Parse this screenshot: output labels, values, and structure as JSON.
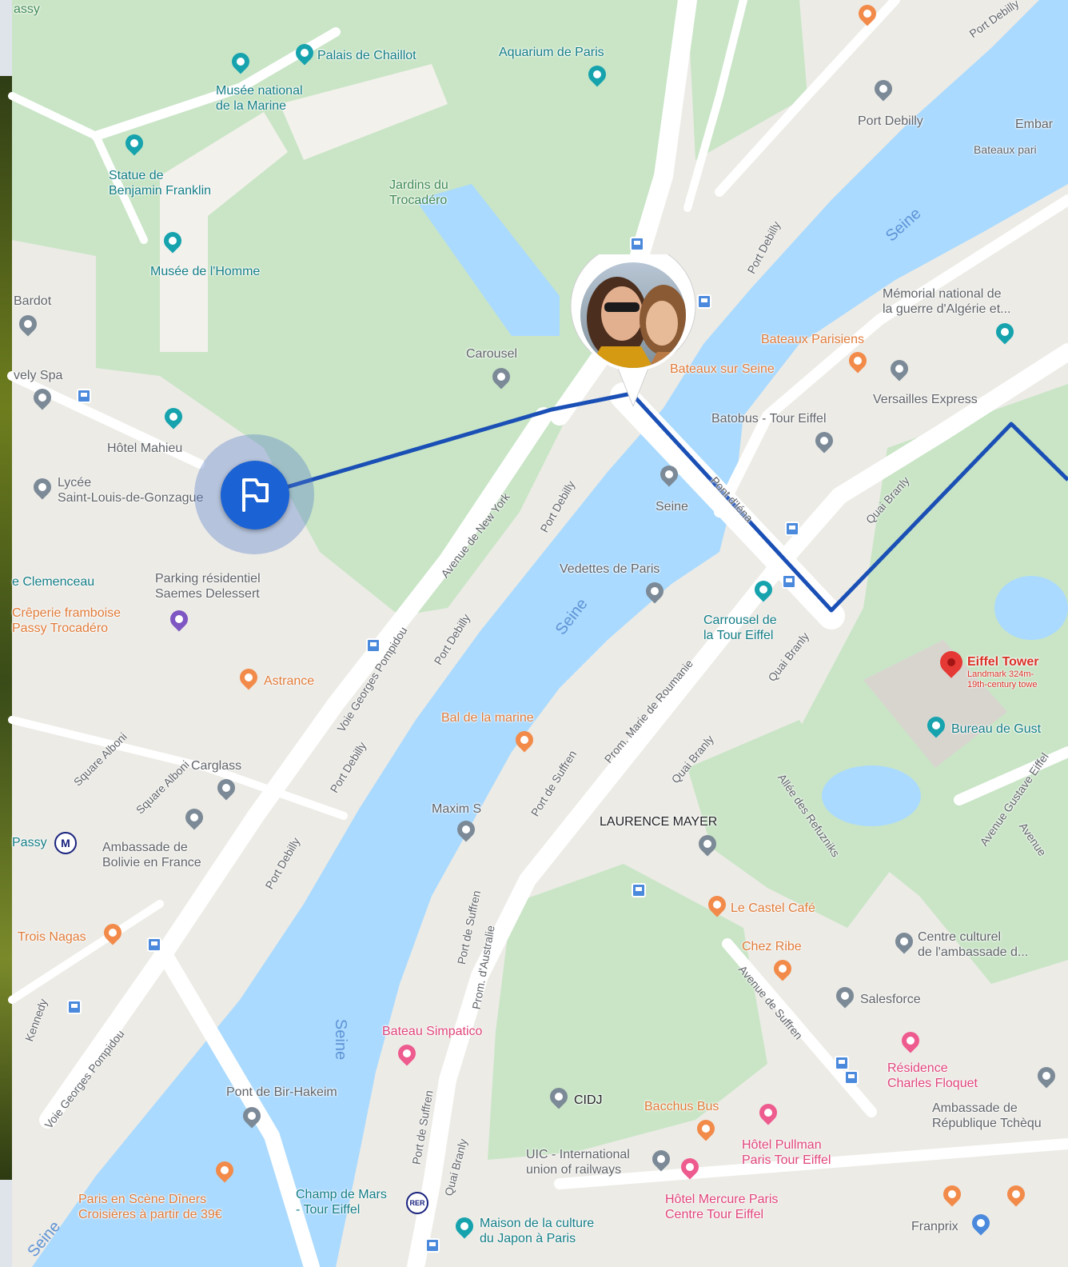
{
  "map": {
    "water": [
      "Seine",
      "Seine",
      "Seine",
      "Seine",
      "Seine"
    ],
    "places": {
      "passy_top": "assy",
      "palais_chaillot": "Palais de Chaillot",
      "aquarium": "Aquarium de Paris",
      "musee_marine": "Musée national\nde la Marine",
      "statue_franklin": "Statue de\nBenjamin Franklin",
      "jardins": "Jardins du\nTrocadéro",
      "musee_homme": "Musée de l'Homme",
      "carousel": "Carousel",
      "bardot": "Bardot",
      "vely_spa": "vely Spa",
      "hotel_mahieu": "Hôtel Mahieu",
      "lycee": "Lycée\nSaint-Louis-de-Gonzague",
      "clemenceau": "e Clemenceau",
      "parking": "Parking résidentiel\nSaemes Delessert",
      "creperie": "Crêperie framboise\nPassy Trocadéro",
      "astrance": "Astrance",
      "carglass": "Carglass",
      "passy": "Passy",
      "ambassade_bolivie": "Ambassade de\nBolivie en France",
      "trois_nagas": "Trois Nagas",
      "port_debilly": "Port Debilly",
      "emba": "Embar",
      "bateaux_pari": "Bateaux pari",
      "memorial": "Mémorial national de\nla guerre d'Algérie et...",
      "bateaux_parisiens": "Bateaux Parisiens",
      "bateaux_sur_seine": "Bateaux sur Seine",
      "versailles_express": "Versailles Express",
      "batobus": "Batobus - Tour Eiffel",
      "seine_stop": "Seine",
      "vedettes": "Vedettes de Paris",
      "carrousel_tour": "Carrousel de\nla Tour Eiffel",
      "eiffel_tower": "Eiffel Tower",
      "eiffel_sub1": "Landmark 324m-",
      "eiffel_sub2": "19th-century towe",
      "bureau_gustave": "Bureau de Gust",
      "bal_marine": "Bal de la marine",
      "maxim": "Maxim S",
      "laurence_mayer": "LAURENCE MAYER",
      "castel_cafe": "Le Castel Café",
      "chez_ribe": "Chez Ribe",
      "centre_culturel": "Centre culturel\nde l'ambassade d...",
      "salesforce": "Salesforce",
      "residence": "Résidence\nCharles Floquet",
      "ambassade_rep": "Ambassade de\nRépublique Tchèqu",
      "bateau_simpatico": "Bateau Simpatico",
      "pont_bir_hakeim": "Pont de Bir-Hakeim",
      "cidj": "CIDJ",
      "bacchus": "Bacchus Bus",
      "hotel_pullman": "Hôtel Pullman\nParis Tour Eiffel",
      "uic": "UIC - International\nunion of railways",
      "hotel_mercure": "Hôtel Mercure Paris\nCentre Tour Eiffel",
      "champ_de_mars": "Champ de Mars\n- Tour Eiffel",
      "maison_japon": "Maison de la culture\ndu Japon à Paris",
      "franprix": "Franprix",
      "paris_en_scene": "Paris en Scène Dîners\nCroisières à partir de 39€",
      "metro_symbol": "M",
      "rer_symbol": "RER"
    },
    "streets": {
      "av_new_york": "Avenue de New York",
      "port_debilly_1": "Port Debilly",
      "port_debilly_2": "Port Debilly",
      "port_debilly_3": "Port Debilly",
      "port_debilly_4": "Port Debilly",
      "port_debilly_5": "Port Debilly",
      "voie_gp_1": "Voie Georges Pompidou",
      "voie_gp_2": "Voie Georges Pompidou",
      "pont_iena": "Pont d'Iéna",
      "quai_branly_1": "Quai Branly",
      "quai_branly_2": "Quai Branly",
      "quai_branly_3": "Quai Branly",
      "quai_branly_4": "Quai Branly",
      "prom_marie": "Prom. Marie de Roumanie",
      "port_suffren_1": "Port de Suffren",
      "port_suffren_2": "Port de Suffren",
      "prom_australie": "Prom. d'Australie",
      "allee_refuzniks": "Allée des Refuzniks",
      "av_suffren": "Avenue de Suffren",
      "av_gustave": "Avenue Gustave Eiffel",
      "avenue_frag": "Avenue",
      "square_alboni_1": "Square Alboni",
      "square_alboni_2": "Square Alboni",
      "frag_quai": "Kennedy",
      "port_debilly_tr": "Port Debilly"
    },
    "colors": {
      "land": "#ecebe6",
      "park": "#c8e6c9",
      "water": "#aadaff",
      "road": "#ffffff",
      "route": "#1a4fb5",
      "start": "#1b63d4",
      "destination": "#e53935"
    },
    "icons": [
      "flag-icon",
      "location-pin-icon",
      "bus-stop-icon",
      "metro-icon",
      "rer-icon"
    ]
  }
}
